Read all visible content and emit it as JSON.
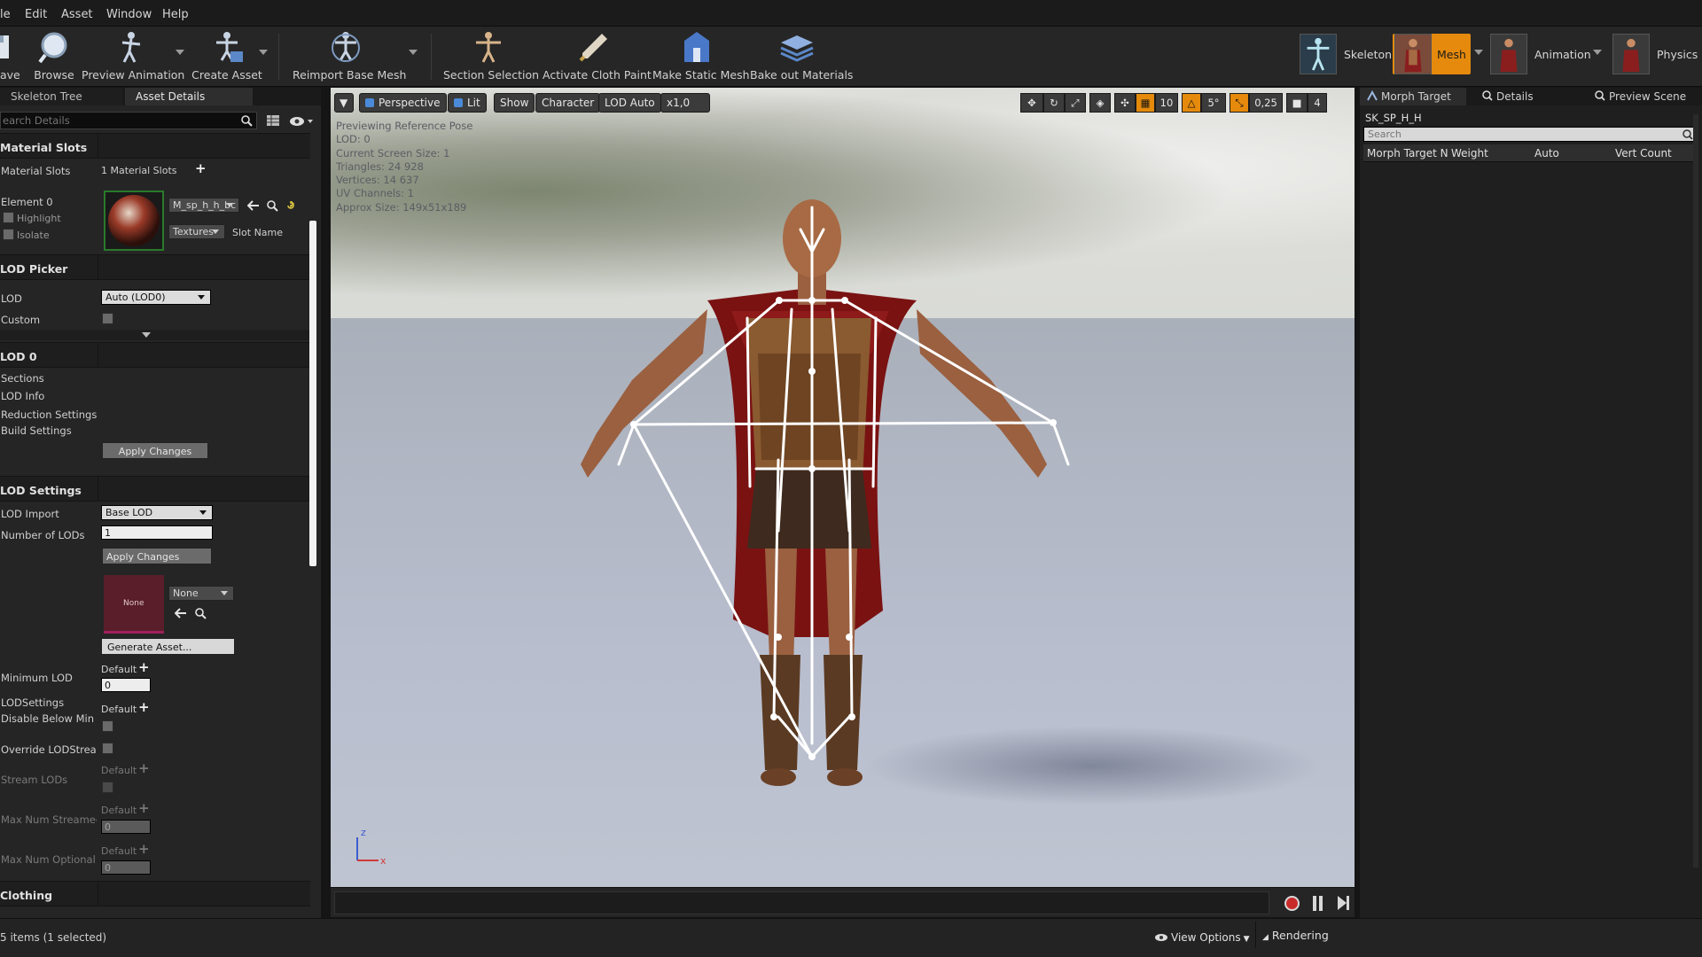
{
  "menu": [
    "le",
    "Edit",
    "Asset",
    "Window",
    "Help"
  ],
  "toolbar": {
    "buttons": [
      {
        "label": "Save",
        "icon": "save-icon"
      },
      {
        "label": "Browse",
        "icon": "browse-icon"
      },
      {
        "label": "Preview Animation",
        "icon": "preview-animation-icon"
      },
      {
        "label": "Create Asset",
        "icon": "create-asset-icon"
      },
      {
        "label": "Reimport Base Mesh",
        "icon": "reimport-icon"
      },
      {
        "label": "Section Selection",
        "icon": "section-selection-icon"
      },
      {
        "label": "Activate Cloth Paint",
        "icon": "cloth-paint-icon"
      },
      {
        "label": "Make Static Mesh",
        "icon": "static-mesh-icon"
      },
      {
        "label": "Bake out Materials",
        "icon": "bake-materials-icon"
      }
    ],
    "save_visible": "ave",
    "modes": [
      {
        "label": "Skeleton",
        "active": false
      },
      {
        "label": "Mesh",
        "active": true
      },
      {
        "label": "Animation",
        "active": false
      },
      {
        "label": "Physics",
        "active": false
      }
    ],
    "accent": "#e58a0c"
  },
  "left": {
    "tabs": [
      "Skeleton Tree",
      "Asset Details"
    ],
    "search_placeholder": "earch Details",
    "material_slots": {
      "section": "Material Slots",
      "label": "Material Slots",
      "value": "1 Material Slots",
      "element": "Element 0",
      "highlight": "Highlight",
      "isolate": "Isolate",
      "material": "M_sp_h_h_bc",
      "textures": "Textures",
      "slot_name": "Slot Name"
    },
    "lod_picker": {
      "section": "LOD Picker",
      "lod_label": "LOD",
      "lod_value": "Auto (LOD0)",
      "custom_label": "Custom"
    },
    "lod0": {
      "section": "LOD 0",
      "items": [
        "Sections",
        "LOD Info",
        "Reduction Settings",
        "Build Settings"
      ],
      "apply": "Apply Changes"
    },
    "lod_settings": {
      "section": "LOD Settings",
      "lod_import_label": "LOD Import",
      "lod_import_value": "Base LOD",
      "num_lods_label": "Number of LODs",
      "num_lods_value": "1",
      "apply": "Apply Changes",
      "lodsettings_label": "LODSettings",
      "lodsettings_thumb": "None",
      "lodsettings_value": "None",
      "generate": "Generate Asset...",
      "min_lod_label": "Minimum LOD",
      "default": "Default",
      "min_lod_value": "0",
      "disable_below_label": "Disable Below Min Lc",
      "override_label": "Override LODStreami",
      "stream_lods_label": "Stream LODs",
      "max_streamed_label": "Max Num Streamed I",
      "max_streamed_value": "0",
      "max_optional_label": "Max Num Optional Lo",
      "max_optional_value": "0"
    },
    "clothing_section": "Clothing"
  },
  "viewport": {
    "menu_arrow": "▼",
    "perspective": "Perspective",
    "lit": "Lit",
    "show": "Show",
    "character": "Character",
    "lod_auto": "LOD Auto",
    "speed": "x1,0",
    "grid_snap": "10",
    "rot_snap": "5°",
    "scale_snap": "0,25",
    "camera_speed": "4",
    "info_lines": [
      "Previewing Reference Pose",
      "LOD: 0",
      "Current Screen Size: 1",
      "Triangles: 24 928",
      "Vertices: 14 637",
      "UV Channels: 1",
      "Approx Size: 149x51x189"
    ],
    "axis_z": "z",
    "axis_x": "x"
  },
  "right": {
    "tabs": [
      "Morph Target",
      "Details",
      "Preview Scene"
    ],
    "mesh_name": "SK_SP_H_H",
    "search_placeholder": "Search",
    "columns": [
      "Morph Target N",
      "Weight",
      "Auto",
      "Vert Count"
    ]
  },
  "status": {
    "items": "5 items (1 selected)",
    "view_options": "View Options",
    "rendering": "Rendering"
  }
}
